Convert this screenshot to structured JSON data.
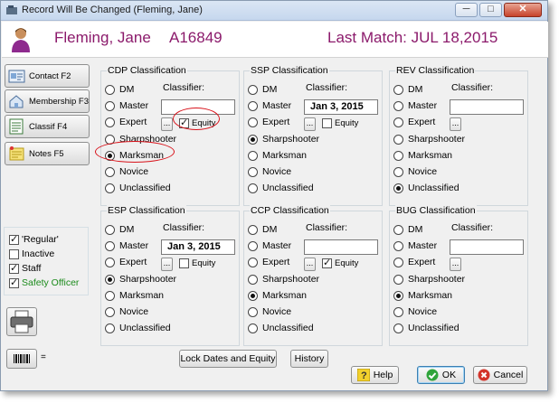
{
  "window": {
    "title": "Record Will Be Changed  (Fleming, Jane)",
    "min": "─",
    "max": "□",
    "close": "✕"
  },
  "header": {
    "name": "Fleming, Jane",
    "id": "A16849",
    "last_match": "Last Match: JUL 18,2015"
  },
  "sidebar": {
    "buttons": [
      {
        "label": "Contact  F2",
        "icon": "contact-card-icon"
      },
      {
        "label": "Membership F3",
        "icon": "membership-icon"
      },
      {
        "label": "Classif  F4",
        "icon": "classification-icon"
      },
      {
        "label": "Notes     F5",
        "icon": "notes-icon"
      }
    ],
    "checks": [
      {
        "label": "'Regular'",
        "checked": true
      },
      {
        "label": "Inactive",
        "checked": false
      },
      {
        "label": "Staff",
        "checked": true
      },
      {
        "label": "Safety Officer",
        "checked": true
      }
    ],
    "barcode_label": "="
  },
  "common": {
    "classifier_label": "Classifier:",
    "equity_label": "Equity",
    "dots": "...",
    "options": [
      "DM",
      "Master",
      "Expert",
      "Sharpshooter",
      "Marksman",
      "Novice",
      "Unclassified"
    ]
  },
  "panels": {
    "cdp": {
      "title": "CDP Classification",
      "selected": "Marksman",
      "classifier": "",
      "equity": true
    },
    "ssp": {
      "title": "SSP Classification",
      "selected": "Sharpshooter",
      "classifier": "Jan 3, 2015",
      "equity": false
    },
    "rev": {
      "title": "REV Classification",
      "selected": "Unclassified",
      "classifier": "",
      "equity": null
    },
    "esp": {
      "title": "ESP Classification",
      "selected": "Sharpshooter",
      "classifier": "Jan 3, 2015",
      "equity": false
    },
    "ccp": {
      "title": "CCP Classification",
      "selected": "Marksman",
      "classifier": "",
      "equity": true
    },
    "bug": {
      "title": "BUG Classification",
      "selected": "Marksman",
      "classifier": "",
      "equity": null
    }
  },
  "footer": {
    "lock_dates": "Lock Dates and Equity",
    "history": "History",
    "help": "Help",
    "ok": "OK",
    "cancel": "Cancel"
  },
  "colors": {
    "header_text": "#8b1a6b",
    "annotation": "#d8121a",
    "safety_officer": "#1a8a1a"
  }
}
